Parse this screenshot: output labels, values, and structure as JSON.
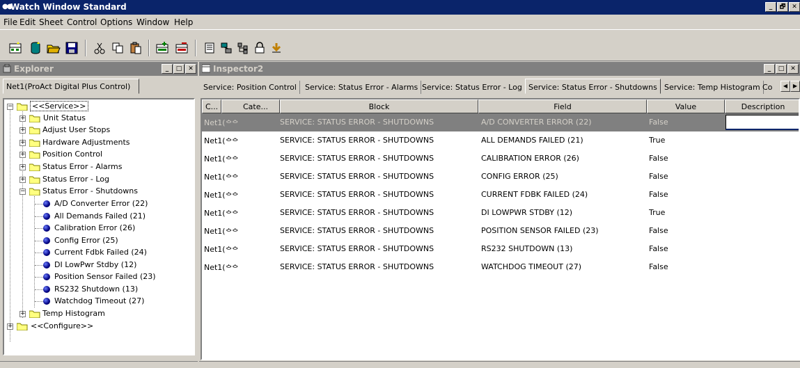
{
  "window": {
    "title": "Watch Window Standard",
    "buttons": [
      "_",
      "🗗",
      "✕"
    ]
  },
  "menu": [
    {
      "label": "File"
    },
    {
      "label": "Edit"
    },
    {
      "label": "Sheet"
    },
    {
      "label": "Control"
    },
    {
      "label": "Options"
    },
    {
      "label": "Window"
    },
    {
      "label": "Help"
    }
  ],
  "toolbar": {
    "icons": [
      "new-sheet-icon",
      "new-item-icon",
      "open-icon",
      "save-icon",
      "cut-icon",
      "copy-icon",
      "paste-icon",
      "add-inspector-icon",
      "remove-inspector-icon",
      "properties-icon",
      "network-icon",
      "tree-icon",
      "lock-icon",
      "arrow-icon"
    ]
  },
  "explorer": {
    "title": "Explorer",
    "tab": "Net1(ProAct Digital Plus Control)",
    "tree": {
      "service_root": "<<Service>>",
      "service_children": [
        "Unit Status",
        "Adjust User Stops",
        "Hardware Adjustments",
        "Position Control",
        "Status Error - Alarms",
        "Status Error - Log",
        "Status Error - Shutdowns"
      ],
      "shutdown_items": [
        "A/D Converter Error (22)",
        "All Demands Failed (21)",
        "Calibration Error (26)",
        "Config Error (25)",
        "Current Fdbk Failed (24)",
        "DI LowPwr Stdby (12)",
        "Position Sensor Failed (23)",
        "RS232 Shutdown (13)",
        "Watchdog Timeout (27)"
      ],
      "after_shutdowns": "Temp Histogram",
      "configure_root": "<<Configure>>"
    }
  },
  "inspector": {
    "title": "Inspector2",
    "tabs": [
      "Service: Position Control",
      "Service: Status Error - Alarms",
      "Service: Status Error - Log",
      "Service: Status Error - Shutdowns",
      "Service: Temp Histogram",
      "Co"
    ],
    "active_tab": "Service: Status Error - Shutdowns",
    "columns": [
      "C...",
      "Cate...",
      "Block",
      "Field",
      "Value",
      "Description"
    ],
    "rows": [
      {
        "c": "Net1(",
        "block": "SERVICE: STATUS ERROR - SHUTDOWNS",
        "field": "A/D CONVERTER ERROR (22)",
        "value": "False"
      },
      {
        "c": "Net1(",
        "block": "SERVICE: STATUS ERROR - SHUTDOWNS",
        "field": "ALL DEMANDS FAILED (21)",
        "value": "True"
      },
      {
        "c": "Net1(",
        "block": "SERVICE: STATUS ERROR - SHUTDOWNS",
        "field": "CALIBRATION ERROR (26)",
        "value": "False"
      },
      {
        "c": "Net1(",
        "block": "SERVICE: STATUS ERROR - SHUTDOWNS",
        "field": "CONFIG ERROR (25)",
        "value": "False"
      },
      {
        "c": "Net1(",
        "block": "SERVICE: STATUS ERROR - SHUTDOWNS",
        "field": "CURRENT FDBK FAILED (24)",
        "value": "False"
      },
      {
        "c": "Net1(",
        "block": "SERVICE: STATUS ERROR - SHUTDOWNS",
        "field": "DI LOWPWR STDBY (12)",
        "value": "True"
      },
      {
        "c": "Net1(",
        "block": "SERVICE: STATUS ERROR - SHUTDOWNS",
        "field": "POSITION SENSOR FAILED (23)",
        "value": "False"
      },
      {
        "c": "Net1(",
        "block": "SERVICE: STATUS ERROR - SHUTDOWNS",
        "field": "RS232 SHUTDOWN (13)",
        "value": "False"
      },
      {
        "c": "Net1(",
        "block": "SERVICE: STATUS ERROR - SHUTDOWNS",
        "field": "WATCHDOG TIMEOUT (27)",
        "value": "False"
      }
    ],
    "selected_row": 0
  },
  "colors": {
    "titlebar": "#0a246a",
    "inactive_title": "#808080",
    "selection": "#808080",
    "face": "#d4d0c8"
  }
}
